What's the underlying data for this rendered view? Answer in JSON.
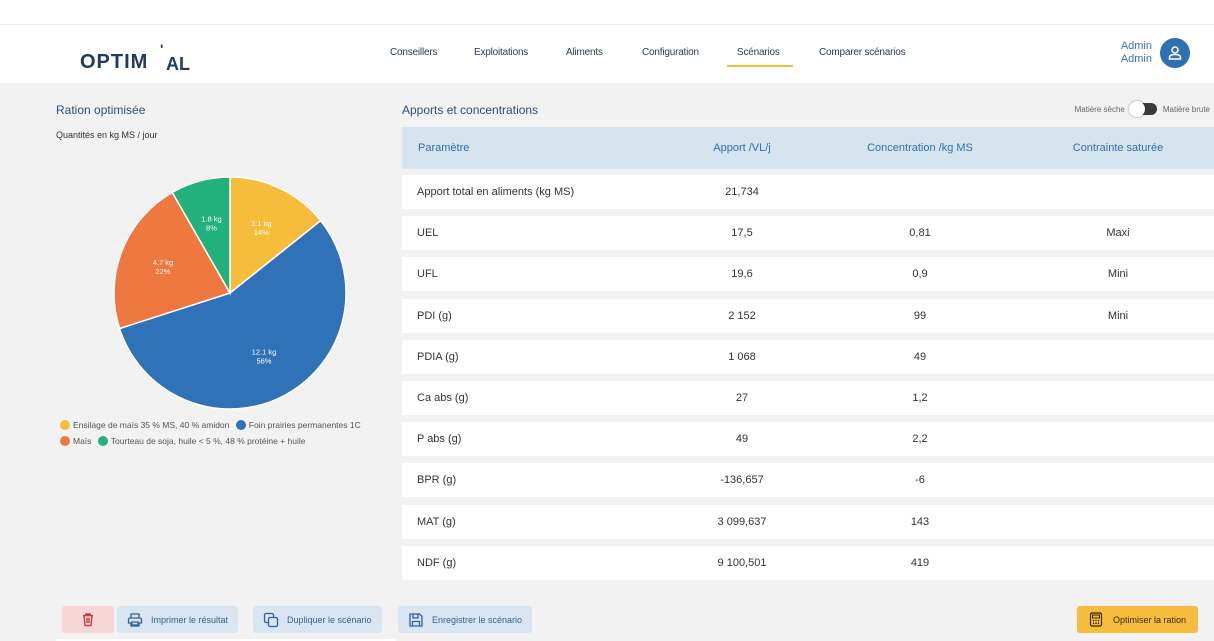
{
  "app": {
    "logo_text": "OPTIM'AL"
  },
  "nav": {
    "items": [
      {
        "label": "Conseillers"
      },
      {
        "label": "Exploitations"
      },
      {
        "label": "Aliments"
      },
      {
        "label": "Configuration"
      },
      {
        "label": "Scénarios",
        "active": true
      },
      {
        "label": "Comparer scénarios"
      }
    ]
  },
  "user": {
    "line1": "Admin",
    "line2": "Admin",
    "icon": "user-icon"
  },
  "left": {
    "title": "Ration optimisée",
    "subtitle": "Quantités en kg MS / jour"
  },
  "chart_data": {
    "type": "pie",
    "title": "",
    "slices": [
      {
        "name": "Ensilage de maïs 35 % MS, 40 % amidon",
        "value": 3.1,
        "label": "3.1 kg",
        "percent": "14%",
        "color": "#f6bd3c"
      },
      {
        "name": "Foin prairies permanentes 1C",
        "value": 12.1,
        "label": "12.1 kg",
        "percent": "56%",
        "color": "#2f72b8"
      },
      {
        "name": "Maïs",
        "value": 4.7,
        "label": "4.7 kg",
        "percent": "22%",
        "color": "#ef7740"
      },
      {
        "name": "Tourteau de soja, huile < 5 %, 48 % protéine + huile",
        "value": 1.8,
        "label": "1.8 kg",
        "percent": "8%",
        "color": "#22b07d"
      }
    ],
    "legend_labels": [
      "Ensilage de maïs 35 % MS, 40 % amidon",
      "Foin prairies permanentes 1C",
      "Maïs",
      "Tourteau de soja, huile < 5 %, 48 % protéine + huile"
    ]
  },
  "right": {
    "title": "Apports et concentrations",
    "toggle_left": "Matière sèche",
    "toggle_right": "Matière brute",
    "headers": [
      "Paramètre",
      "Apport /VL/j",
      "Concentration /kg MS",
      "Contrainte saturée"
    ],
    "rows": [
      [
        "Apport total en aliments (kg MS)",
        "21,734",
        "",
        ""
      ],
      [
        "UEL",
        "17,5",
        "0,81",
        "Maxi"
      ],
      [
        "UFL",
        "19,6",
        "0,9",
        "Mini"
      ],
      [
        "PDI (g)",
        "2 152",
        "99",
        "Mini"
      ],
      [
        "PDIA (g)",
        "1 068",
        "49",
        ""
      ],
      [
        "Ca abs (g)",
        "27",
        "1,2",
        ""
      ],
      [
        "P abs (g)",
        "49",
        "2,2",
        ""
      ],
      [
        "BPR (g)",
        "-136,657",
        "-6",
        ""
      ],
      [
        "MAT (g)",
        "3 099,637",
        "143",
        ""
      ],
      [
        "NDF (g)",
        "9 100,501",
        "419",
        ""
      ]
    ]
  },
  "actions": {
    "delete_icon": "trash-icon",
    "print_label": "Imprimer le résultat",
    "duplicate_label": "Dupliquer le scénario",
    "save_label": "Enregistrer le scénario",
    "optimize_label": "Optimiser la ration"
  }
}
